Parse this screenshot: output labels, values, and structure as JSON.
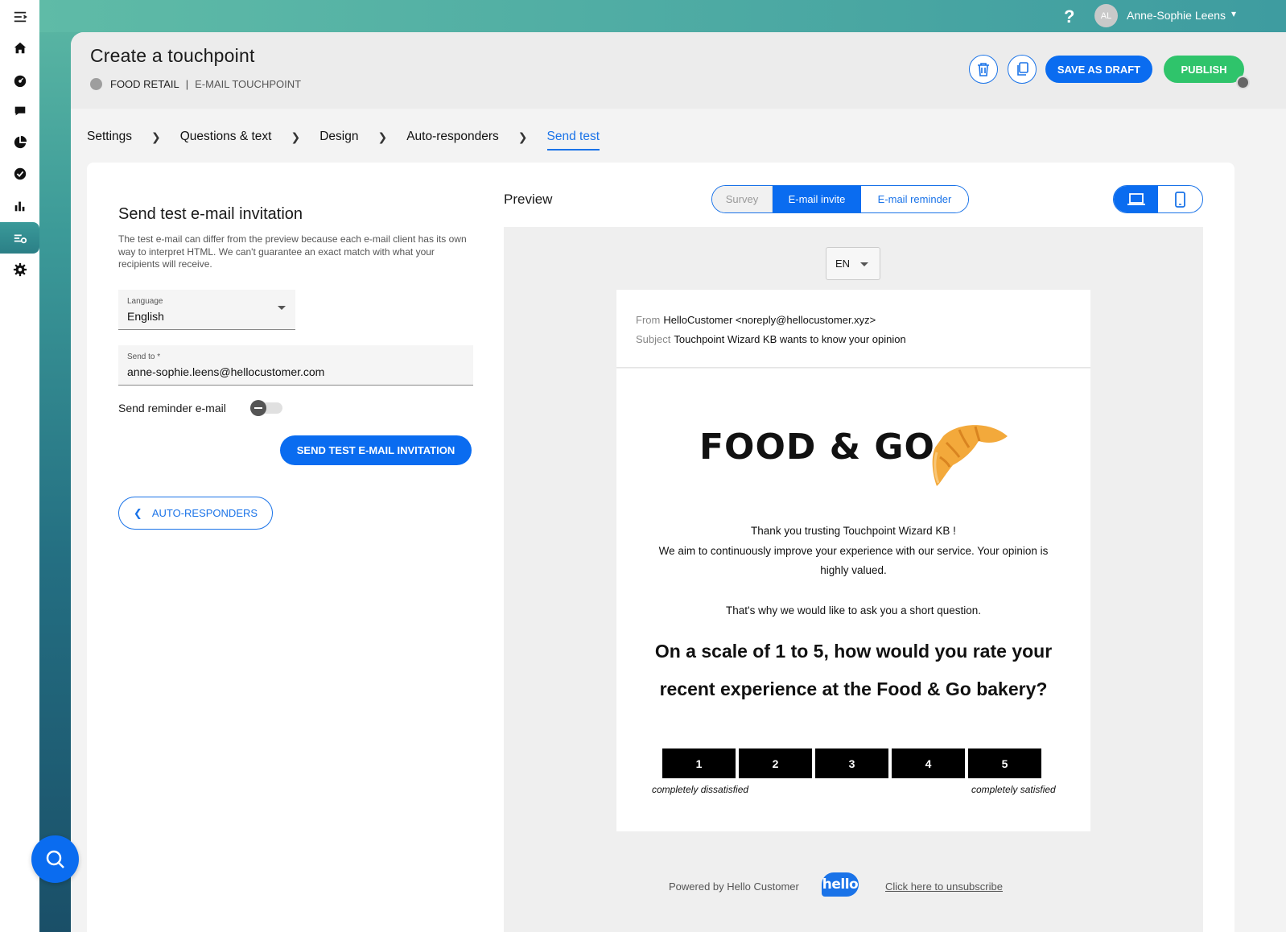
{
  "user": {
    "initials": "AL",
    "name": "Anne-Sophie Leens",
    "help": "?"
  },
  "header": {
    "title": "Create a touchpoint",
    "breadcrumb_company": "FOOD RETAIL",
    "breadcrumb_sep": "|",
    "breadcrumb_type": "E-MAIL TOUCHPOINT",
    "save_draft_label": "SAVE AS DRAFT",
    "publish_label": "PUBLISH"
  },
  "steps": [
    "Settings",
    "Questions & text",
    "Design",
    "Auto-responders",
    "Send test"
  ],
  "steps_active": "Send test",
  "form": {
    "title": "Send test e-mail invitation",
    "description": "The test e-mail can differ from the preview because each e-mail client has its own way to interpret HTML. We can't guarantee an exact match with what your recipients will receive.",
    "language_label": "Language",
    "language_value": "English",
    "send_to_label": "Send to *",
    "send_to_value": "anne-sophie.leens@hellocustomer.com",
    "reminder_label": "Send reminder e-mail",
    "reminder_on": false,
    "send_button_label": "SEND TEST E-MAIL INVITATION",
    "back_button_label": "AUTO-RESPONDERS"
  },
  "preview": {
    "title": "Preview",
    "tabs": [
      "Survey",
      "E-mail invite",
      "E-mail reminder"
    ],
    "active_tab": "E-mail invite",
    "device_active": "desktop",
    "language": "EN",
    "from_key": "From",
    "from_value": "HelloCustomer <noreply@hellocustomer.xyz>",
    "subject_key": "Subject",
    "subject_value": "Touchpoint Wizard KB wants to know your opinion",
    "logo_text": "FOOD & GO",
    "intro_line1": "Thank you trusting Touchpoint Wizard KB !",
    "intro_line2": "We aim to continuously improve your experience with our service. Your opinion is highly valued.",
    "intro_line3": "That's why we would like to ask you a short question.",
    "question": "On a scale of 1 to 5, how would you rate your recent experience at the Food & Go bakery?",
    "scale": [
      "1",
      "2",
      "3",
      "4",
      "5"
    ],
    "scale_low_label": "completely dissatisfied",
    "scale_high_label": "completely satisfied",
    "powered_by": "Powered by Hello Customer",
    "hello_logo": "hello",
    "unsubscribe": "Click here to unsubscribe"
  },
  "colors": {
    "primary": "#0a6cf0",
    "publish": "#2fc46b",
    "teal": "#3e9ca0"
  }
}
